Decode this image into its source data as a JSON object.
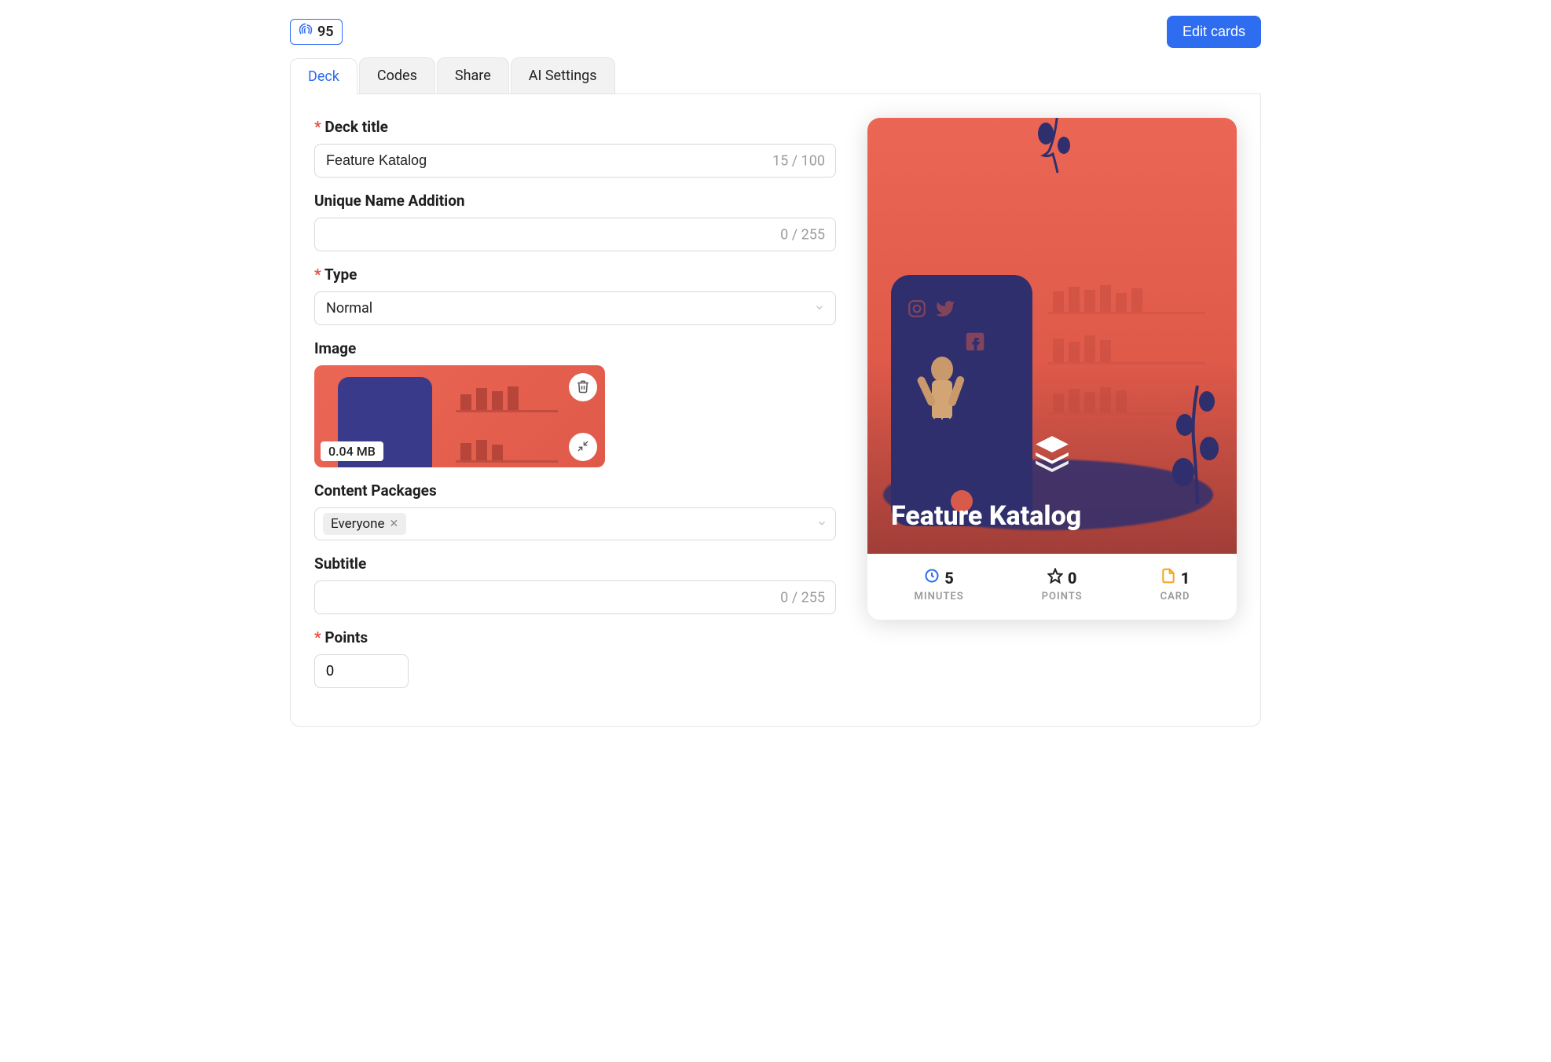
{
  "topbar": {
    "fingerprint_count": "95",
    "edit_cards_label": "Edit cards"
  },
  "tabs": [
    "Deck",
    "Codes",
    "Share",
    "AI Settings"
  ],
  "form": {
    "deck_title_label": "Deck title",
    "deck_title_value": "Feature Katalog",
    "deck_title_count": "15 / 100",
    "unique_name_label": "Unique Name Addition",
    "unique_name_value": "",
    "unique_name_count": "0 / 255",
    "type_label": "Type",
    "type_value": "Normal",
    "image_label": "Image",
    "image_size": "0.04 MB",
    "content_packages_label": "Content Packages",
    "content_packages_tags": [
      "Everyone"
    ],
    "subtitle_label": "Subtitle",
    "subtitle_value": "",
    "subtitle_count": "0 / 255",
    "points_label": "Points",
    "points_value": "0"
  },
  "preview": {
    "title": "Feature Katalog",
    "stats": {
      "minutes_value": "5",
      "minutes_label": "MINUTES",
      "points_value": "0",
      "points_label": "POINTS",
      "card_value": "1",
      "card_label": "CARD"
    }
  }
}
